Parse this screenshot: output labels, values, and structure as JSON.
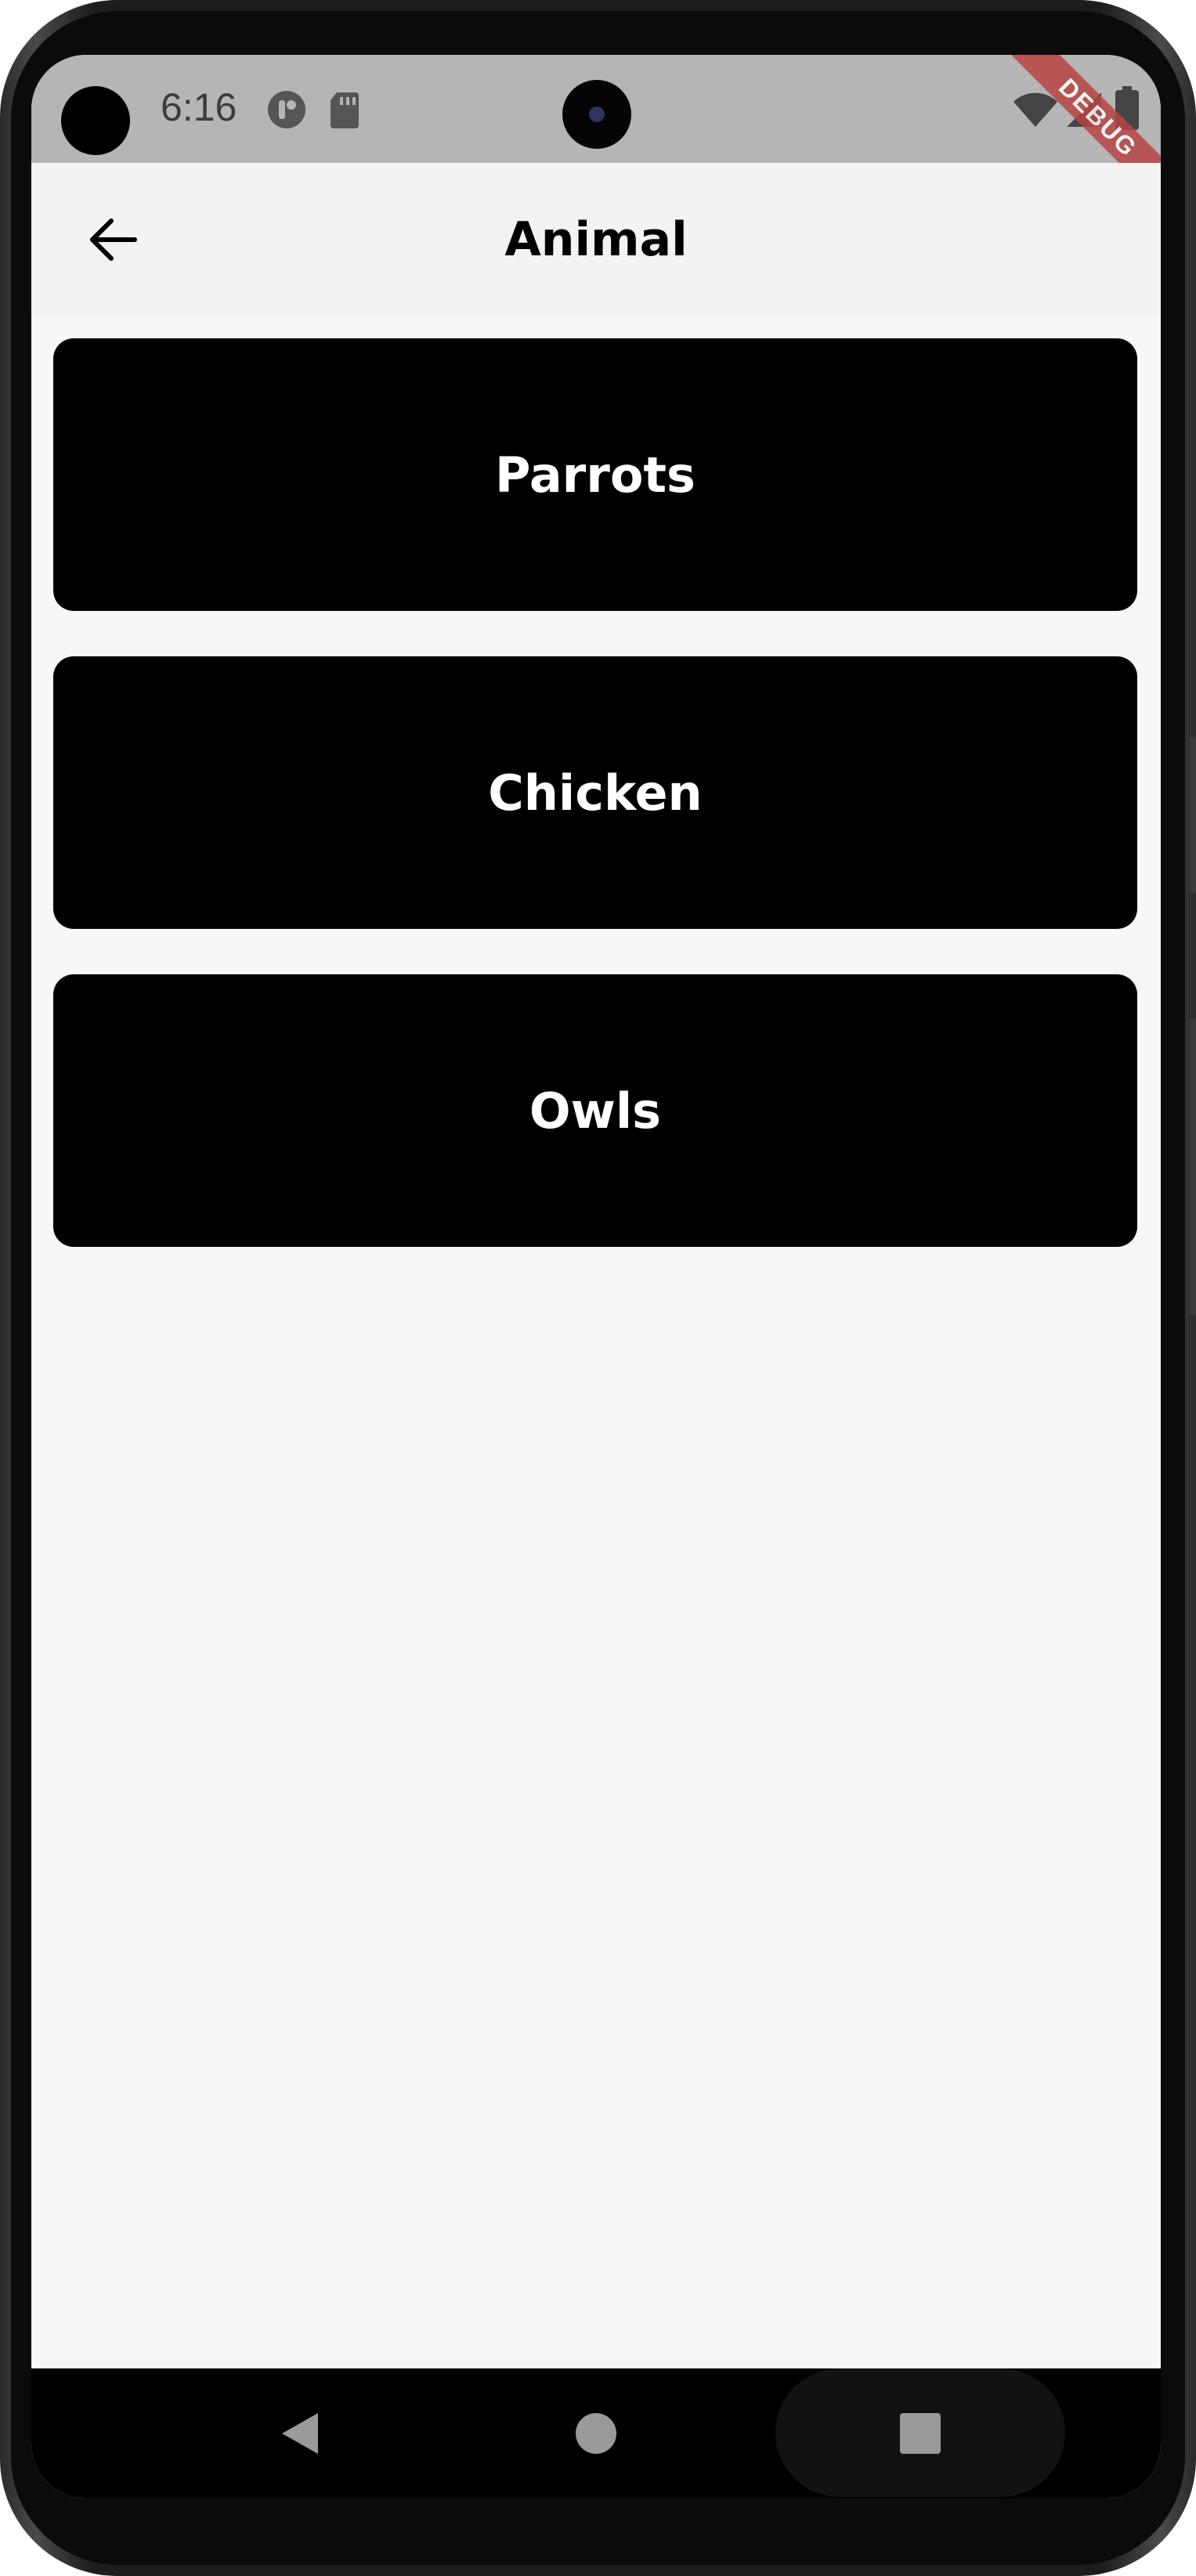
{
  "status_bar": {
    "time": "6:16",
    "icons": [
      "notification-app-icon",
      "sd-card-icon",
      "wifi-icon",
      "signal-icon",
      "battery-icon"
    ],
    "debug_banner": "DEBUG"
  },
  "app_bar": {
    "title": "Animal",
    "back_icon": "arrow-back-icon"
  },
  "animals": [
    {
      "label": "Parrots"
    },
    {
      "label": "Chicken"
    },
    {
      "label": "Owls"
    }
  ],
  "nav_bar": {
    "back_icon": "triangle-back-icon",
    "home_icon": "circle-home-icon",
    "recents_icon": "square-recents-icon"
  },
  "colors": {
    "card_background": "#000000",
    "card_text": "#ffffff",
    "page_background": "#f7f7f7",
    "app_bar_background": "#f3f3f3",
    "status_bar_background": "#b5b5b5"
  }
}
